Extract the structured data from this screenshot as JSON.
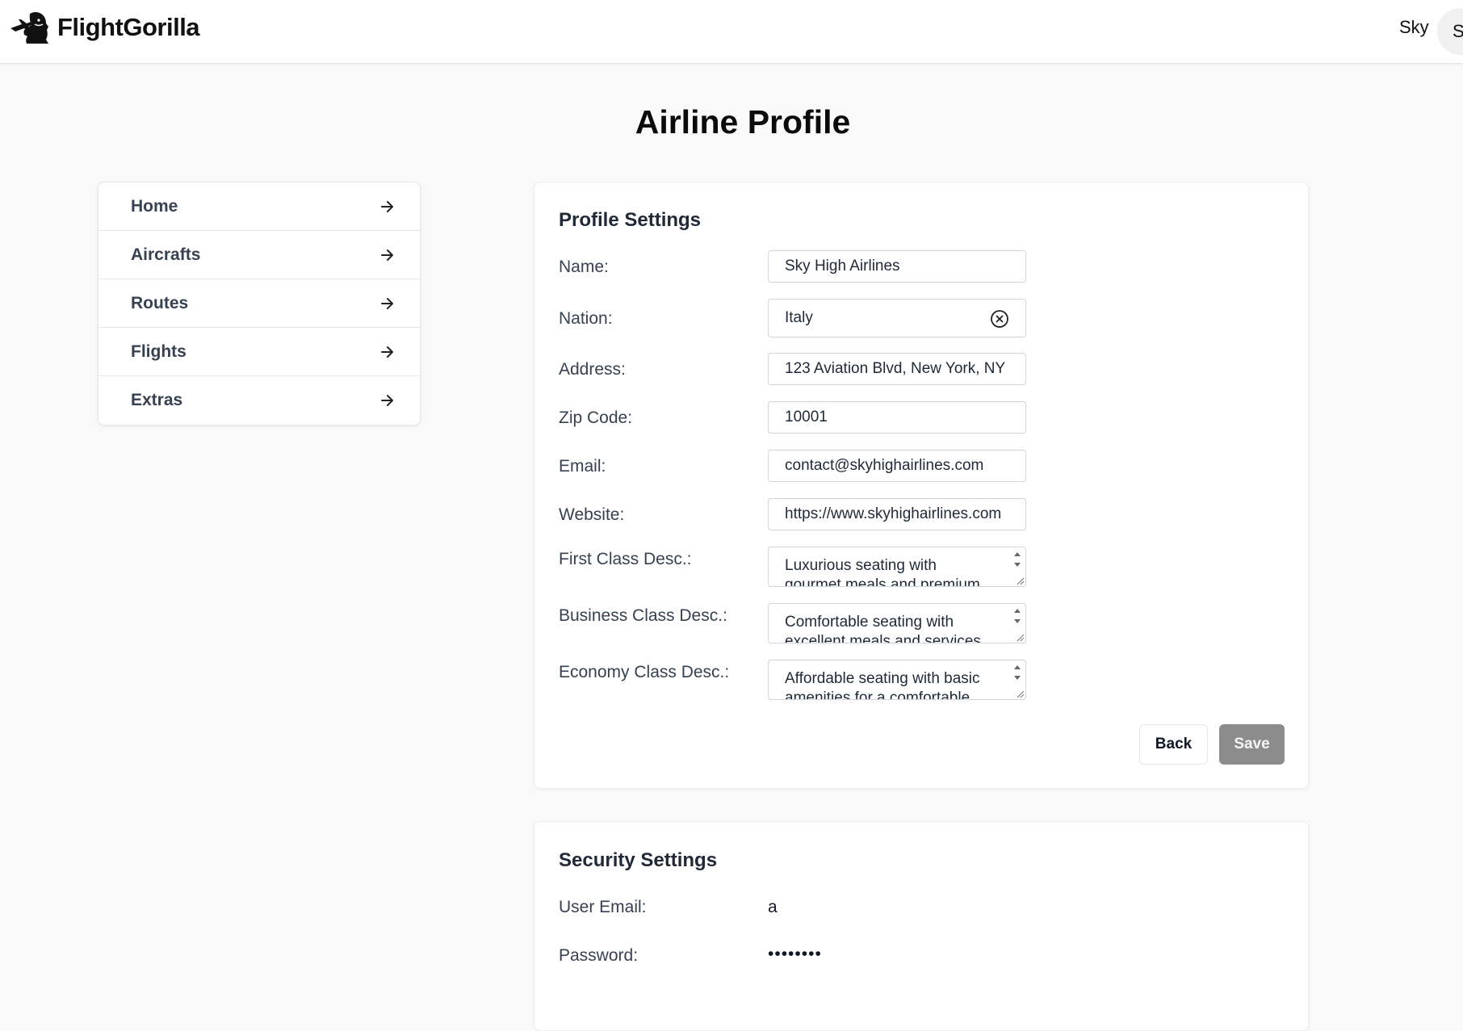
{
  "header": {
    "app_name": "FlightGorilla",
    "logo_icon": "gorilla-airplane-logo",
    "user_name": "Sky",
    "avatar_initial": "S"
  },
  "page": {
    "title": "Airline Profile"
  },
  "sidebar": {
    "items": [
      {
        "label": "Home"
      },
      {
        "label": "Aircrafts"
      },
      {
        "label": "Routes"
      },
      {
        "label": "Flights"
      },
      {
        "label": "Extras"
      }
    ]
  },
  "profile": {
    "title": "Profile Settings",
    "fields": {
      "name": {
        "label": "Name:",
        "value": "Sky High Airlines"
      },
      "nation": {
        "label": "Nation:",
        "value": "Italy"
      },
      "address": {
        "label": "Address:",
        "value": "123 Aviation Blvd, New York, NY"
      },
      "zip": {
        "label": "Zip Code:",
        "value": "10001"
      },
      "email": {
        "label": "Email:",
        "value": "contact@skyhighairlines.com"
      },
      "website": {
        "label": "Website:",
        "value": "https://www.skyhighairlines.com"
      },
      "first_class": {
        "label": "First Class Desc.:",
        "value": "Luxurious seating with gourmet meals and premium"
      },
      "business_class": {
        "label": "Business Class Desc.:",
        "value": "Comfortable seating with excellent meals and services"
      },
      "economy_class": {
        "label": "Economy Class Desc.:",
        "value": "Affordable seating with basic amenities for a comfortable"
      }
    },
    "buttons": {
      "back": "Back",
      "save": "Save"
    }
  },
  "security": {
    "title": "Security Settings",
    "user_email": {
      "label": "User Email:",
      "value": "a"
    },
    "password": {
      "label": "Password:",
      "value": "••••••••"
    }
  },
  "colors": {
    "background": "#f9f9f9",
    "card": "#ffffff",
    "save_disabled": "#8c8c8c",
    "text": "#1f2937"
  }
}
